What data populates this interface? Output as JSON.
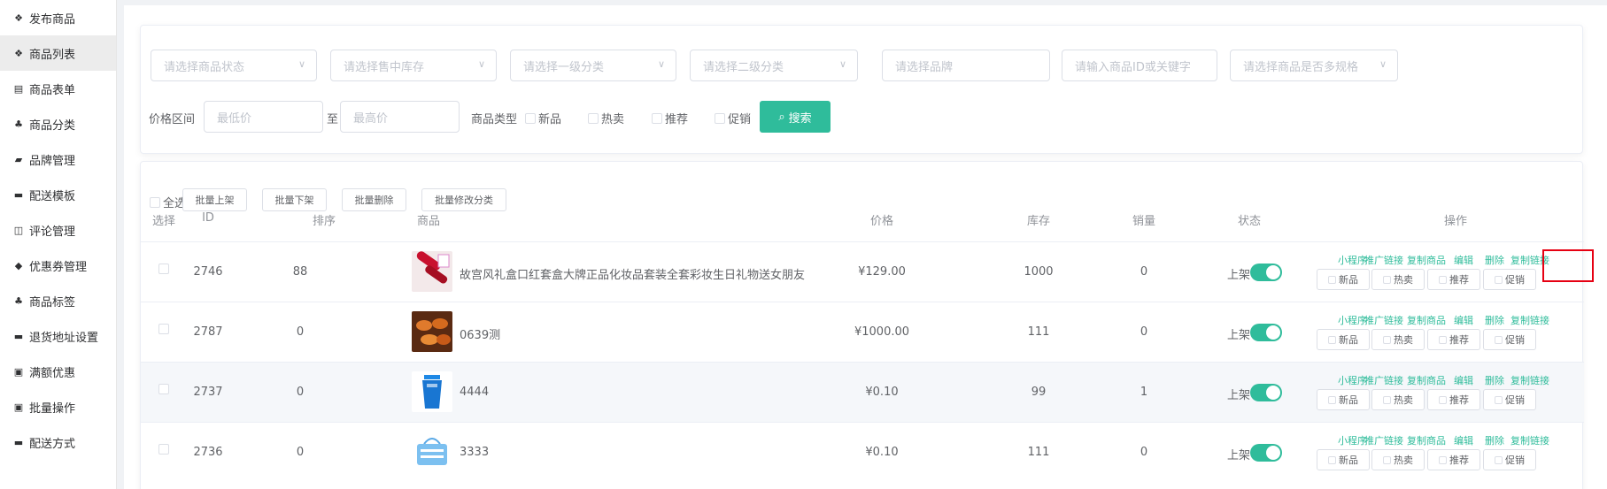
{
  "sidebar": {
    "items": [
      {
        "icon": "cubes-icon",
        "glyph": "❖",
        "label": "发布商品",
        "active": false
      },
      {
        "icon": "cubes-icon",
        "glyph": "❖",
        "label": "商品列表",
        "active": true
      },
      {
        "icon": "document-icon",
        "glyph": "▤",
        "label": "商品表单",
        "active": false
      },
      {
        "icon": "sitemap-icon",
        "glyph": "♣",
        "label": "商品分类",
        "active": false
      },
      {
        "icon": "briefcase-icon",
        "glyph": "▰",
        "label": "品牌管理",
        "active": false
      },
      {
        "icon": "truck-icon",
        "glyph": "▬",
        "label": "配送模板",
        "active": false
      },
      {
        "icon": "columns-icon",
        "glyph": "◫",
        "label": "评论管理",
        "active": false
      },
      {
        "icon": "tag-icon",
        "glyph": "◆",
        "label": "优惠券管理",
        "active": false
      },
      {
        "icon": "sitemap-icon",
        "glyph": "♣",
        "label": "商品标签",
        "active": false
      },
      {
        "icon": "truck-icon",
        "glyph": "▬",
        "label": "退货地址设置",
        "active": false
      },
      {
        "icon": "gift-icon",
        "glyph": "▣",
        "label": "满额优惠",
        "active": false
      },
      {
        "icon": "gift-icon",
        "glyph": "▣",
        "label": "批量操作",
        "active": false
      },
      {
        "icon": "truck-icon",
        "glyph": "▬",
        "label": "配送方式",
        "active": false
      }
    ]
  },
  "filters": {
    "status_placeholder": "请选择商品状态",
    "stock_placeholder": "请选择售中库存",
    "cat1_placeholder": "请选择一级分类",
    "cat2_placeholder": "请选择二级分类",
    "brand_placeholder": "请选择品牌",
    "keyword_placeholder": "请输入商品ID或关键字",
    "spec_placeholder": "请选择商品是否多规格",
    "price_label": "价格区间",
    "min_placeholder": "最低价",
    "to_label": "至",
    "max_placeholder": "最高价",
    "type_label": "商品类型",
    "types": [
      "新品",
      "热卖",
      "推荐",
      "促销"
    ],
    "search_label": "搜索"
  },
  "bulk": {
    "select_all": "全选",
    "on_shelf": "批量上架",
    "off_shelf": "批量下架",
    "delete": "批量删除",
    "change_category": "批量修改分类"
  },
  "table": {
    "headers": {
      "select": "选择",
      "id": "ID",
      "sort": "排序",
      "product": "商品",
      "price": "价格",
      "stock": "库存",
      "sales": "销量",
      "status": "状态",
      "ops": "操作"
    },
    "ops": [
      "小程序",
      "推广链接",
      "复制商品",
      "编辑",
      "删除",
      "复制链接"
    ],
    "tags": [
      "新品",
      "热卖",
      "推荐",
      "促销"
    ],
    "rows": [
      {
        "id": "2746",
        "sort": "88",
        "name": "故宫风礼盒口红套盒大牌正品化妆品套装全套彩妆生日礼物送女朋友",
        "price": "¥129.00",
        "stock": "1000",
        "sales": "0",
        "status": "上架",
        "thumb": "lipstick-thumb"
      },
      {
        "id": "2787",
        "sort": "0",
        "name": "0639测",
        "price": "¥1000.00",
        "stock": "111",
        "sales": "0",
        "status": "上架",
        "thumb": "food-thumb"
      },
      {
        "id": "2737",
        "sort": "0",
        "name": "4444",
        "price": "¥0.10",
        "stock": "99",
        "sales": "1",
        "status": "上架",
        "thumb": "bin-thumb"
      },
      {
        "id": "2736",
        "sort": "0",
        "name": "3333",
        "price": "¥0.10",
        "stock": "111",
        "sales": "0",
        "status": "上架",
        "thumb": "basket-thumb"
      }
    ]
  },
  "colors": {
    "accent": "#2fbc9b",
    "highlight": "#e60012"
  }
}
